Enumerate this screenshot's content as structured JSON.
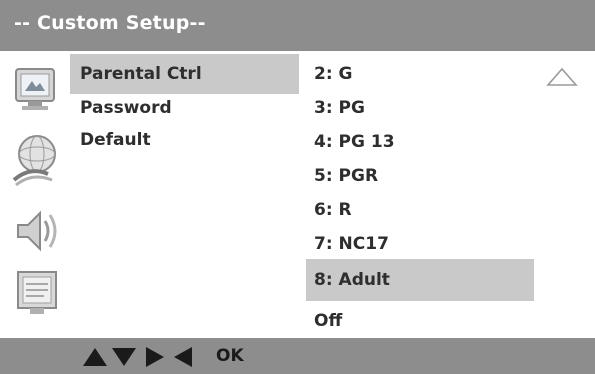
{
  "header": {
    "title": "-- Custom Setup--"
  },
  "left_menu": {
    "items": [
      {
        "label": "Parental Ctrl",
        "selected": true
      },
      {
        "label": "Password",
        "selected": false
      },
      {
        "label": "Default",
        "selected": false
      }
    ],
    "icons": [
      "setup-monitor-icon",
      "audio-globe-icon",
      "speaker-sound-icon",
      "picture-screen-icon"
    ]
  },
  "ratings": {
    "items": [
      {
        "label": "2:  G",
        "selected": false
      },
      {
        "label": "3:  PG",
        "selected": false
      },
      {
        "label": "4:  PG 13",
        "selected": false
      },
      {
        "label": "5:  PGR",
        "selected": false
      },
      {
        "label": "6:  R",
        "selected": false
      },
      {
        "label": "7:  NC17",
        "selected": false
      },
      {
        "label": "8:  Adult",
        "selected": true
      },
      {
        "label": "Off",
        "selected": false
      }
    ],
    "scroll_indicator": "up-triangle-icon"
  },
  "footer": {
    "ok_label": "OK",
    "nav_icons": [
      "up",
      "down",
      "right",
      "left"
    ]
  },
  "colors": {
    "bar": "#8d8d8d",
    "highlight": "#c9c9c9",
    "text": "#2e2e2e",
    "title_text": "#ffffff"
  }
}
